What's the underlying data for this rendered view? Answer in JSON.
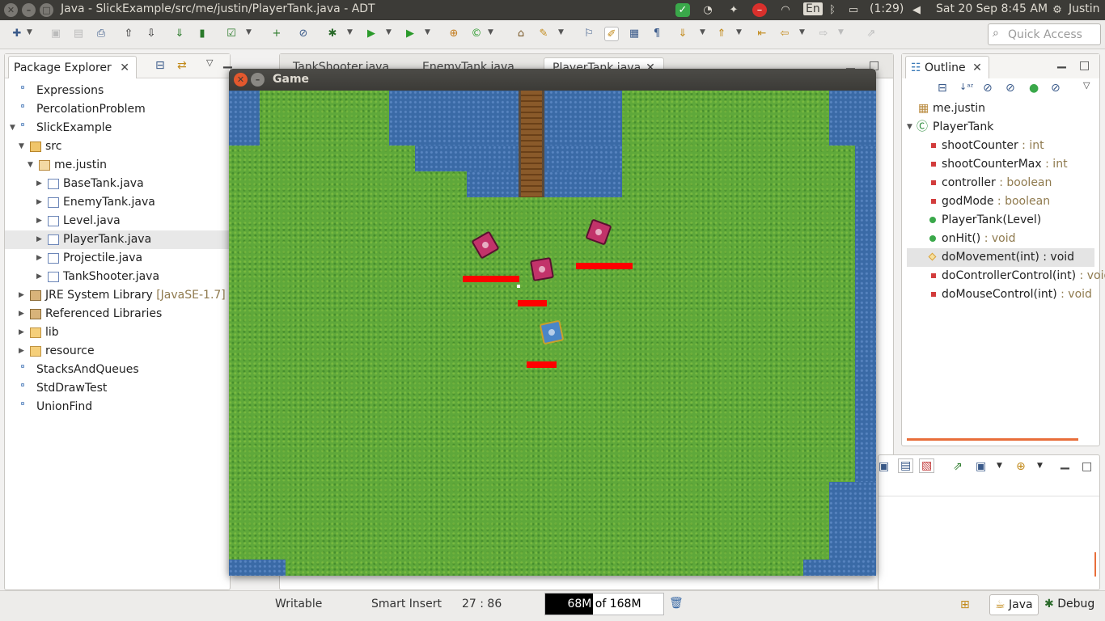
{
  "window_title": "Java - SlickExample/src/me/justin/PlayerTank.java - ADT",
  "system_tray": {
    "language": "En",
    "battery": "(1:29)",
    "datetime": "Sat 20 Sep  8:45 AM",
    "user": "Justin"
  },
  "quick_access": {
    "placeholder": "Quick Access"
  },
  "package_explorer": {
    "title": "Package Explorer",
    "tree": [
      {
        "label": "Expressions",
        "level": 0,
        "icon": "project-icon",
        "twisty": ""
      },
      {
        "label": "PercolationProblem",
        "level": 0,
        "icon": "project-icon",
        "twisty": ""
      },
      {
        "label": "SlickExample",
        "level": 0,
        "icon": "project-icon",
        "twisty": "open"
      },
      {
        "label": "src",
        "level": 1,
        "icon": "source-folder-icon",
        "twisty": "open"
      },
      {
        "label": "me.justin",
        "level": 2,
        "icon": "package-icon",
        "twisty": "open"
      },
      {
        "label": "BaseTank.java",
        "level": 3,
        "icon": "java-file-icon",
        "twisty": "closed"
      },
      {
        "label": "EnemyTank.java",
        "level": 3,
        "icon": "java-file-icon",
        "twisty": "closed"
      },
      {
        "label": "Level.java",
        "level": 3,
        "icon": "java-file-icon",
        "twisty": "closed"
      },
      {
        "label": "PlayerTank.java",
        "level": 3,
        "icon": "java-file-icon",
        "twisty": "closed",
        "selected": true
      },
      {
        "label": "Projectile.java",
        "level": 3,
        "icon": "java-file-icon",
        "twisty": "closed"
      },
      {
        "label": "TankShooter.java",
        "level": 3,
        "icon": "java-file-icon",
        "twisty": "closed"
      },
      {
        "label": "JRE System Library",
        "suffix": "[JavaSE-1.7]",
        "level": 1,
        "icon": "library-icon",
        "twisty": "closed"
      },
      {
        "label": "Referenced Libraries",
        "level": 1,
        "icon": "library-icon",
        "twisty": "closed"
      },
      {
        "label": "lib",
        "level": 1,
        "icon": "folder-icon",
        "twisty": "closed"
      },
      {
        "label": "resource",
        "level": 1,
        "icon": "folder-icon",
        "twisty": "closed"
      },
      {
        "label": "StacksAndQueues",
        "level": 0,
        "icon": "project-icon",
        "twisty": ""
      },
      {
        "label": "StdDrawTest",
        "level": 0,
        "icon": "project-icon",
        "twisty": ""
      },
      {
        "label": "UnionFind",
        "level": 0,
        "icon": "project-icon",
        "twisty": ""
      }
    ]
  },
  "editor_tabs": [
    "TankShooter.java",
    "EnemyTank.java",
    "PlayerTank.java"
  ],
  "outline": {
    "title": "Outline",
    "items": [
      {
        "name": "me.justin",
        "type": "",
        "kind": "package",
        "level": 0
      },
      {
        "name": "PlayerTank",
        "type": "",
        "kind": "class",
        "level": 0
      },
      {
        "name": "shootCounter",
        "type": " : int",
        "kind": "field",
        "level": 1
      },
      {
        "name": "shootCounterMax",
        "type": " : int",
        "kind": "field",
        "level": 1
      },
      {
        "name": "controller",
        "type": " : boolean",
        "kind": "field",
        "level": 1
      },
      {
        "name": "godMode",
        "type": " : boolean",
        "kind": "field",
        "level": 1
      },
      {
        "name": "PlayerTank(Level)",
        "type": "",
        "kind": "constructor",
        "level": 1
      },
      {
        "name": "onHit()",
        "type": " : void",
        "kind": "public-method",
        "level": 1
      },
      {
        "name": "doMovement(int)",
        "type": " : void",
        "kind": "protected-method",
        "level": 1,
        "selected": true
      },
      {
        "name": "doControllerControl(int)",
        "type": " : void",
        "kind": "private-method",
        "level": 1
      },
      {
        "name": "doMouseControl(int)",
        "type": " : void",
        "kind": "private-method",
        "level": 1
      }
    ]
  },
  "game_window": {
    "title": "Game"
  },
  "status_bar": {
    "writable": "Writable",
    "insert_mode": "Smart Insert",
    "position": "27 : 86",
    "heap": "68M of 168M",
    "heap_fraction": 0.405
  },
  "perspectives": {
    "java": "Java",
    "debug": "Debug"
  }
}
